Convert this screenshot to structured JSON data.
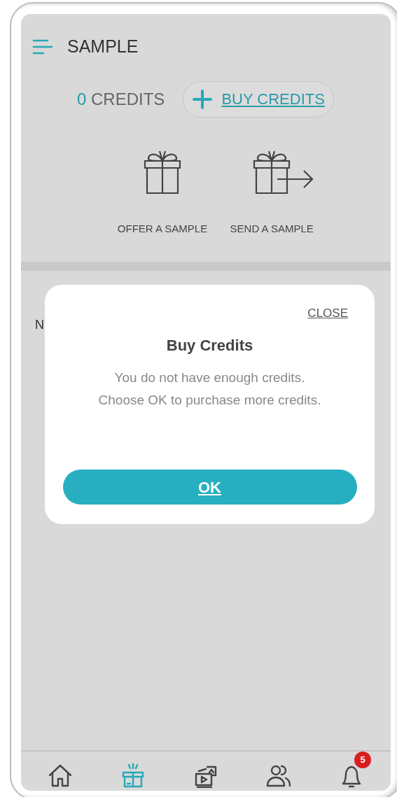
{
  "header": {
    "title": "SAMPLE"
  },
  "credits": {
    "count": "0",
    "label": "CREDITS",
    "buy_button": "BUY CREDITS"
  },
  "actions": [
    {
      "kind": "offer",
      "label": "OFFER A SAMPLE"
    },
    {
      "kind": "send",
      "label": "SEND A SAMPLE"
    }
  ],
  "hidden_text": "N",
  "dialog": {
    "close": "CLOSE",
    "title": "Buy Credits",
    "message": [
      "You do not have enough credits.",
      "Choose OK to purchase more credits."
    ],
    "ok": "OK"
  },
  "bottom_nav": [
    {
      "kind": "home",
      "selected": false
    },
    {
      "kind": "gift",
      "selected": true
    },
    {
      "kind": "media",
      "selected": false
    },
    {
      "kind": "people",
      "selected": false
    },
    {
      "kind": "bell",
      "selected": false,
      "badge": "5"
    }
  ]
}
